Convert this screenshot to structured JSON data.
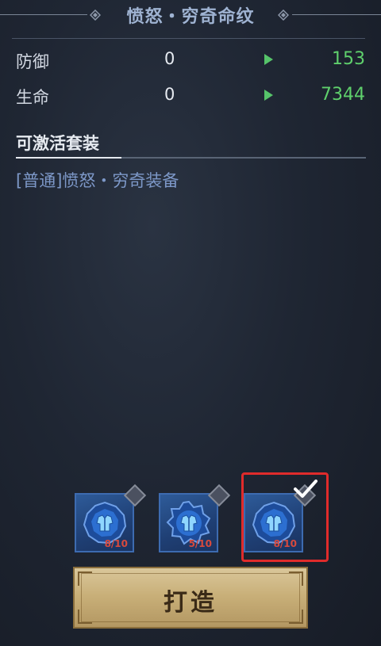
{
  "header": {
    "title": "愤怒・穷奇命纹"
  },
  "stats": [
    {
      "label": "防御",
      "old": "0",
      "new": "153"
    },
    {
      "label": "生命",
      "old": "0",
      "new": "7344"
    }
  ],
  "set_section": {
    "title": "可激活套装",
    "items": [
      "[普通]愤怒・穷奇装备"
    ]
  },
  "slots": [
    {
      "count": "8/10",
      "selected": false,
      "icon": "armor-gem-icon"
    },
    {
      "count": "5/10",
      "selected": false,
      "icon": "armor-gem-icon"
    },
    {
      "count": "8/10",
      "selected": true,
      "icon": "armor-gem-icon"
    }
  ],
  "forge_button": {
    "label": "打造"
  },
  "colors": {
    "title": "#9fb3d2",
    "stat_new": "#5fd06c",
    "set_item": "#7d98c8",
    "selected_border": "#e02b2b",
    "slot_bg": "#2e5b99",
    "count_text": "#d84a3d"
  }
}
